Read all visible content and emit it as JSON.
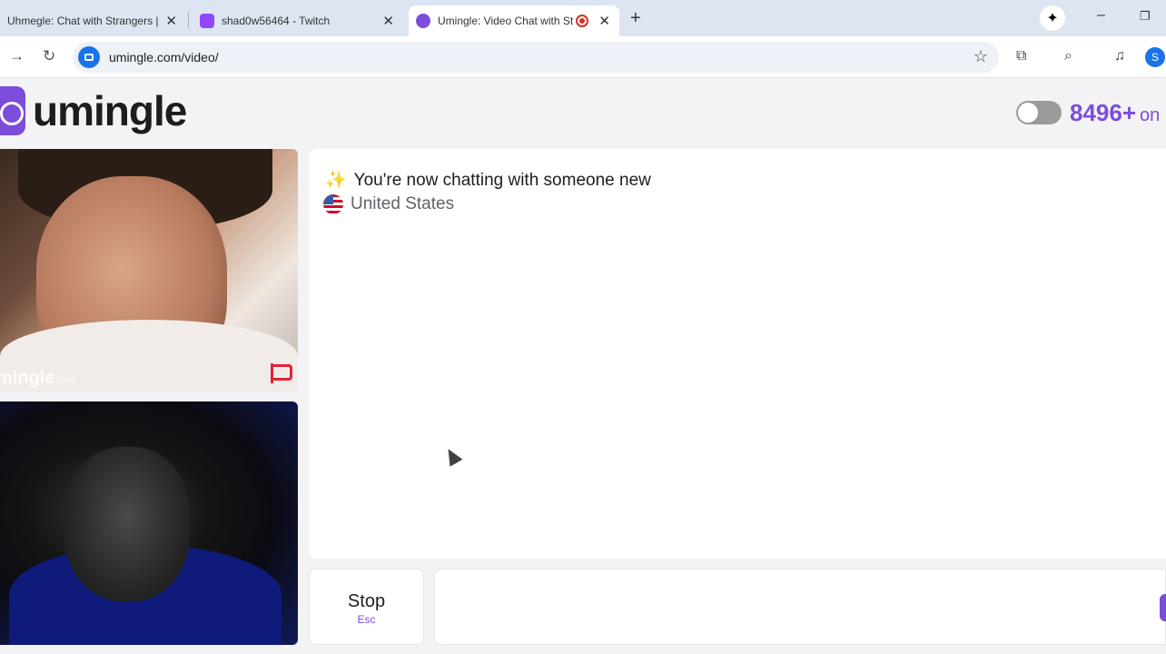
{
  "browser": {
    "tabs": [
      {
        "title": "Uhmegle: Chat with Strangers |",
        "close": "✕"
      },
      {
        "title": "shad0w56464 - Twitch",
        "close": "✕"
      },
      {
        "title": "Umingle: Video Chat with St",
        "close": "✕"
      }
    ],
    "new_tab": "+",
    "address": "umingle.com/video/",
    "profile_initial": "S"
  },
  "site": {
    "logo_text": "umingle",
    "online_count": "8496+",
    "online_label": "on"
  },
  "videos": {
    "watermark_main": "mingle",
    "watermark_suffix": ".com"
  },
  "chat": {
    "status": "You're now chatting with someone new",
    "sparkle": "✨",
    "country": "United States"
  },
  "controls": {
    "stop_label": "Stop",
    "stop_key": "Esc"
  },
  "colors": {
    "brand": "#7c4ddb",
    "report_flag": "#e0243a"
  }
}
